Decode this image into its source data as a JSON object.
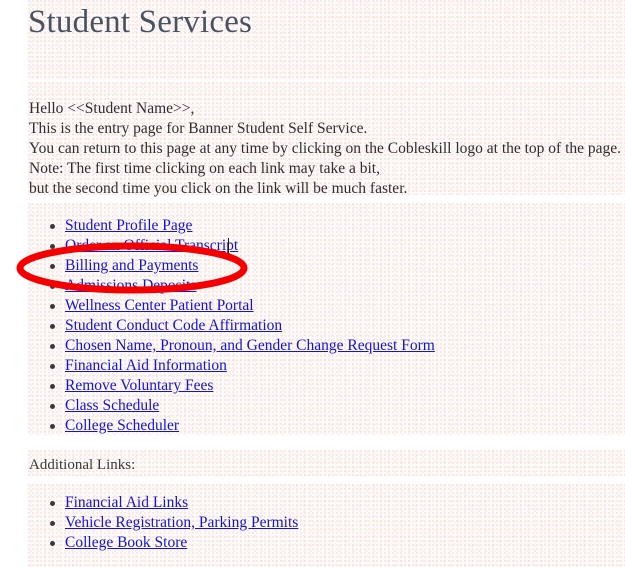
{
  "page": {
    "title": "Student Services",
    "intro_lines": [
      "Hello <<Student Name>>,",
      "This is the entry page for Banner Student Self Service.",
      "You can return to this page at any time by clicking on the Cobleskill logo at the top of the page.",
      "Note: The first time clicking on each link may take a bit,",
      "but the second time you click on the link will be much faster."
    ],
    "additional_heading": "Additional Links:"
  },
  "main_links": [
    {
      "label": "Student Profile Page"
    },
    {
      "label": "Order an Official Transcript"
    },
    {
      "label": "Billing and Payments"
    },
    {
      "label": "Admissions Deposits"
    },
    {
      "label": "Wellness Center Patient Portal"
    },
    {
      "label": "Student Conduct Code Affirmation"
    },
    {
      "label": "Chosen Name, Pronoun, and Gender Change Request Form"
    },
    {
      "label": "Financial Aid Information"
    },
    {
      "label": "Remove Voluntary Fees"
    },
    {
      "label": "Class Schedule"
    },
    {
      "label": "College Scheduler"
    }
  ],
  "additional_links": [
    {
      "label": "Financial Aid Links"
    },
    {
      "label": "Vehicle Registration, Parking Permits"
    },
    {
      "label": "College Book Store"
    }
  ],
  "annotation": {
    "shape": "ellipse",
    "color": "#f40000",
    "targets": "Billing and Payments"
  },
  "colors": {
    "link": "#1414cf",
    "heading": "#4a5160",
    "body_text": "#2e2e2e",
    "page_background": "#fdfbf9",
    "annotation_red": "#f40000"
  }
}
